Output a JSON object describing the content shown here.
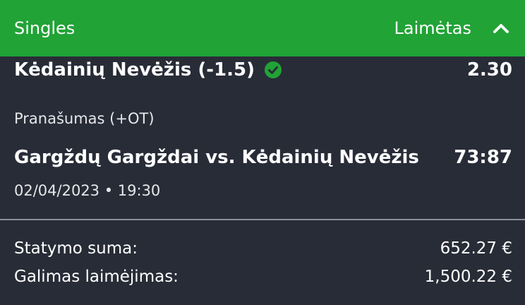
{
  "header": {
    "title": "Singles",
    "status": "Laimėtas",
    "toggle_icon": "chevron-up-icon"
  },
  "bet": {
    "selection": "Kėdainių Nevėžis (-1.5)",
    "result_icon": "check-circle-icon",
    "odds": "2.30",
    "market": "Pranašumas (+OT)",
    "event": "Gargždų Gargždai vs. Kėdainių Nevėžis",
    "score": "73:87",
    "datetime": "02/04/2023 • 19:30"
  },
  "summary": {
    "stake_label": "Statymo suma:",
    "stake_value": "652.27 €",
    "win_label": "Galimas laimėjimas:",
    "win_value": "1,500.22 €"
  },
  "colors": {
    "header_bg": "#21a336",
    "card_bg": "#282c37",
    "check": "#21a336",
    "divider": "#8d909a"
  }
}
